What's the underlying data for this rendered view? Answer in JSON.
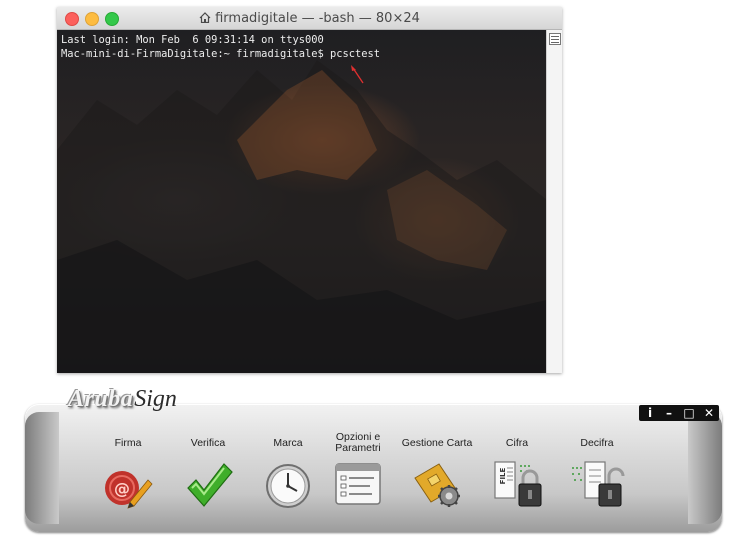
{
  "terminal": {
    "title": "firmadigitale — -bash — 80×24",
    "lines": [
      "Last login: Mon Feb  6 09:31:14 on ttys000",
      "Mac-mini-di-FirmaDigitale:~ firmadigitale$ pcsctest"
    ]
  },
  "arubasign": {
    "logo_aruba": "Aruba",
    "logo_sign": "Sign",
    "window_controls": [
      "i",
      "–",
      "□",
      "✕"
    ],
    "tools": [
      {
        "label": "Firma",
        "icon": "signature-pen-icon"
      },
      {
        "label": "Verifica",
        "icon": "checkmark-icon"
      },
      {
        "label": "Marca",
        "icon": "clock-icon"
      },
      {
        "label": "Opzioni e Parametri",
        "icon": "options-list-icon"
      },
      {
        "label": "Gestione Carta",
        "icon": "smartcard-gear-icon"
      },
      {
        "label": "Cifra",
        "icon": "lock-file-icon"
      },
      {
        "label": "Decifra",
        "icon": "unlock-file-icon"
      }
    ]
  },
  "colors": {
    "terminal_text": "#eeeeee",
    "annotation_arrow": "#e03030",
    "control_bar": "#111111"
  }
}
